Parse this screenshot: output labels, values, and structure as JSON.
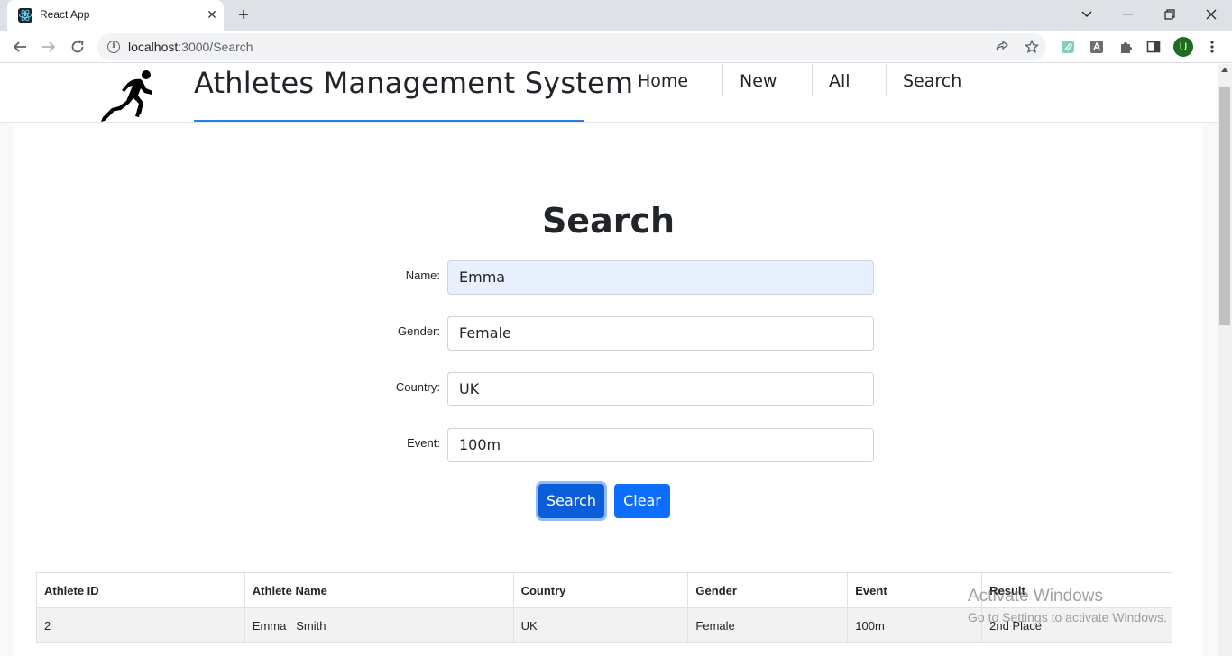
{
  "browser": {
    "tab_title": "React App",
    "url_host": "localhost",
    "url_port_path": ":3000/Search",
    "profile_initial": "U"
  },
  "app": {
    "brand": "Athletes Management System",
    "nav": [
      "Home",
      "New",
      "All",
      "Search"
    ],
    "accent_color": "#0d6efd"
  },
  "form": {
    "title": "Search",
    "fields": [
      {
        "label": "Name:",
        "value": "Emma"
      },
      {
        "label": "Gender:",
        "value": "Female"
      },
      {
        "label": "Country:",
        "value": "UK"
      },
      {
        "label": "Event:",
        "value": "100m"
      }
    ],
    "search_label": "Search",
    "clear_label": "Clear"
  },
  "results": {
    "headers": [
      "Athlete ID",
      "Athlete Name",
      "Country",
      "Gender",
      "Event",
      "Result"
    ],
    "rows": [
      [
        "2",
        "Emma   Smith",
        "UK",
        "Female",
        "100m",
        "2nd Place"
      ]
    ]
  },
  "watermark": {
    "line1": "Activate Windows",
    "line2": "Go to Settings to activate Windows."
  }
}
